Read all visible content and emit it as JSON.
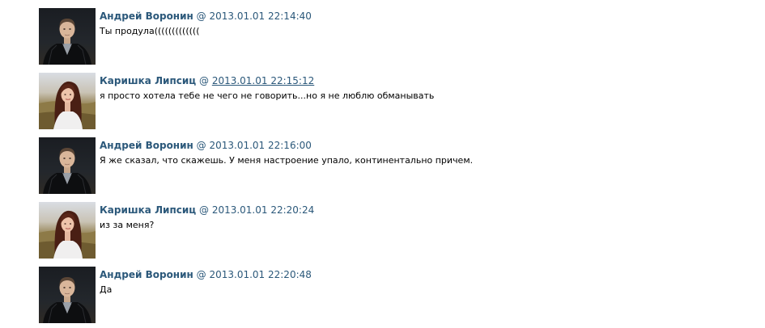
{
  "messages": [
    {
      "author": "Андрей Воронин",
      "separator": "@",
      "timestamp": "2013.01.01 22:14:40",
      "text": "Ты продула(((((((((((((",
      "avatar": "man-in-black-jacket-photo"
    },
    {
      "author": "Каришка Липсиц",
      "separator": "@",
      "timestamp": "2013.01.01 22:15:12",
      "text": "я просто хотела тебе не чего не говорить...но я не люблю обманывать",
      "avatar": "woman-in-field-photo"
    },
    {
      "author": "Андрей Воронин",
      "separator": "@",
      "timestamp": "2013.01.01 22:16:00",
      "text": "Я же сказал, что скажешь. У меня настроение упало, континентально причем.",
      "avatar": "man-in-black-jacket-photo"
    },
    {
      "author": "Каришка Липсиц",
      "separator": "@",
      "timestamp": "2013.01.01 22:20:24",
      "text": "из за меня?",
      "avatar": "woman-in-field-photo"
    },
    {
      "author": "Андрей Воронин",
      "separator": "@",
      "timestamp": "2013.01.01 22:20:48",
      "text": "Да",
      "avatar": "man-in-black-jacket-photo"
    }
  ],
  "colors": {
    "link": "#2b587a",
    "text": "#000000",
    "background": "#ffffff"
  }
}
